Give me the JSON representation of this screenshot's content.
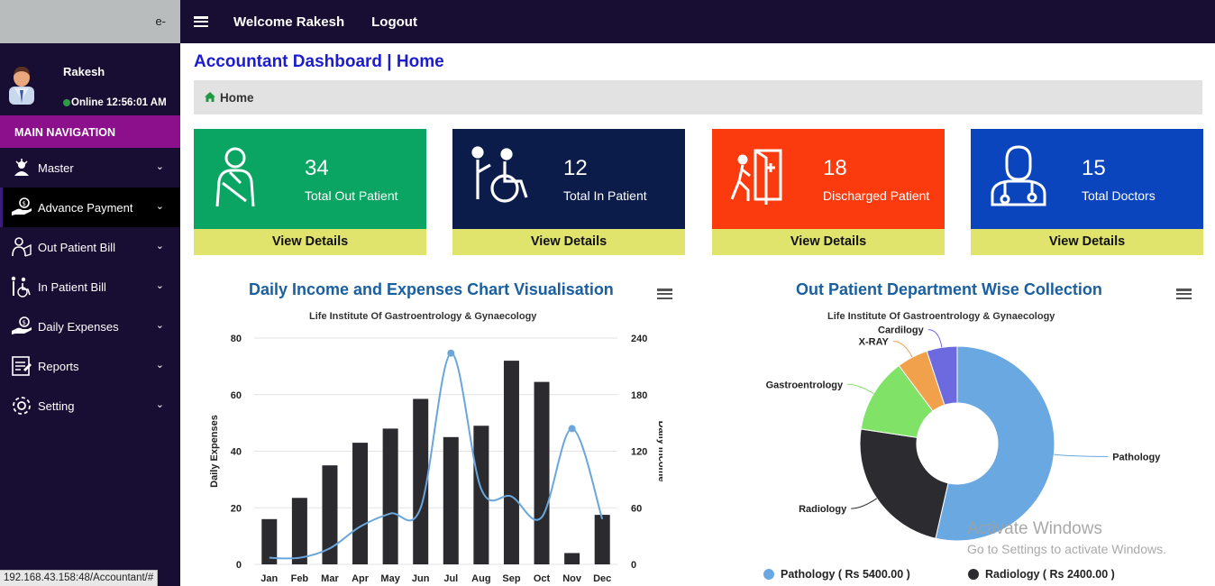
{
  "sidebar": {
    "brand": "e-",
    "user_name": "Rakesh",
    "status_text": "Online 12:56:01 AM",
    "main_nav_label": "MAIN NAVIGATION",
    "items": [
      {
        "label": "Master",
        "icon": "master-icon"
      },
      {
        "label": "Advance Payment",
        "icon": "advance-payment-icon"
      },
      {
        "label": "Out Patient Bill",
        "icon": "out-patient-bill-icon"
      },
      {
        "label": "In Patient Bill",
        "icon": "in-patient-bill-icon"
      },
      {
        "label": "Daily Expenses",
        "icon": "daily-expenses-icon"
      },
      {
        "label": "Reports",
        "icon": "reports-icon"
      },
      {
        "label": "Setting",
        "icon": "gear-icon"
      }
    ],
    "active_index": 1
  },
  "topbar": {
    "welcome": "Welcome Rakesh",
    "logout": "Logout"
  },
  "page": {
    "title": "Accountant Dashboard | Home",
    "breadcrumb": "Home"
  },
  "cards": [
    {
      "value": "34",
      "label": "Total Out Patient",
      "button": "View Details",
      "color": "#0aa562",
      "icon": "out-patient-icon"
    },
    {
      "value": "12",
      "label": "Total In Patient",
      "button": "View Details",
      "color": "#0b1c4b",
      "icon": "wheelchair-icon"
    },
    {
      "value": "18",
      "label": "Discharged Patient",
      "button": "View Details",
      "color": "#fb3b0d",
      "icon": "exit-door-icon"
    },
    {
      "value": "15",
      "label": "Total Doctors",
      "button": "View Details",
      "color": "#0b45be",
      "icon": "doctor-icon"
    }
  ],
  "chart_data": [
    {
      "type": "bar",
      "title": "Daily Income and Expenses Chart Visualisation",
      "subtitle": "Life Institute Of Gastroentrology & Gynaecology",
      "categories": [
        "Jan",
        "Feb",
        "Mar",
        "Apr",
        "May",
        "Jun",
        "Jul",
        "Aug",
        "Sep",
        "Oct",
        "Nov",
        "Dec"
      ],
      "series": [
        {
          "name": "Daily Expenses",
          "type": "bar",
          "axis": "left",
          "color": "#2b2b2f",
          "values": [
            16,
            23.5,
            35,
            43,
            48,
            58.5,
            45,
            49,
            72,
            64.5,
            4,
            17.5
          ]
        },
        {
          "name": "Daily Income",
          "type": "spline",
          "axis": "right",
          "color": "#6aa6dc",
          "values": [
            7,
            7,
            17,
            40,
            54,
            60,
            224,
            80,
            72,
            50,
            144,
            48
          ]
        }
      ],
      "ylabel": "Daily Expenses",
      "ylabel_right": "Daily Income",
      "ylim": [
        0,
        80
      ],
      "yticks": [
        0,
        20,
        40,
        60,
        80
      ],
      "ylim_right": [
        0,
        240
      ],
      "yticks_right": [
        0,
        60,
        120,
        180,
        240
      ],
      "grid": true
    },
    {
      "type": "pie",
      "title": "Out Patient Department Wise Collection",
      "subtitle": "Life Institute Of Gastroentrology & Gynaecology",
      "slices": [
        {
          "name": "Pathology",
          "value": 5400,
          "color": "#6aa8e2"
        },
        {
          "name": "Radiology",
          "value": 2400,
          "color": "#2b2b30"
        },
        {
          "name": "Gastroentrology",
          "value": 1250,
          "color": "#80e367"
        },
        {
          "name": "X-RAY",
          "value": 520,
          "color": "#f1a04c"
        },
        {
          "name": "Cardilogy",
          "value": 510,
          "color": "#6d6ae0"
        }
      ],
      "legend": [
        {
          "text": "Pathology ( Rs 5400.00 )",
          "color": "#6aa8e2"
        },
        {
          "text": "Radiology ( Rs 2400.00 )",
          "color": "#2b2b30"
        }
      ],
      "donut": true
    }
  ],
  "watermark": {
    "line1": "Activate Windows",
    "line2": "Go to Settings to activate Windows."
  },
  "status_url": "192.168.43.158:48/Accountant/#"
}
